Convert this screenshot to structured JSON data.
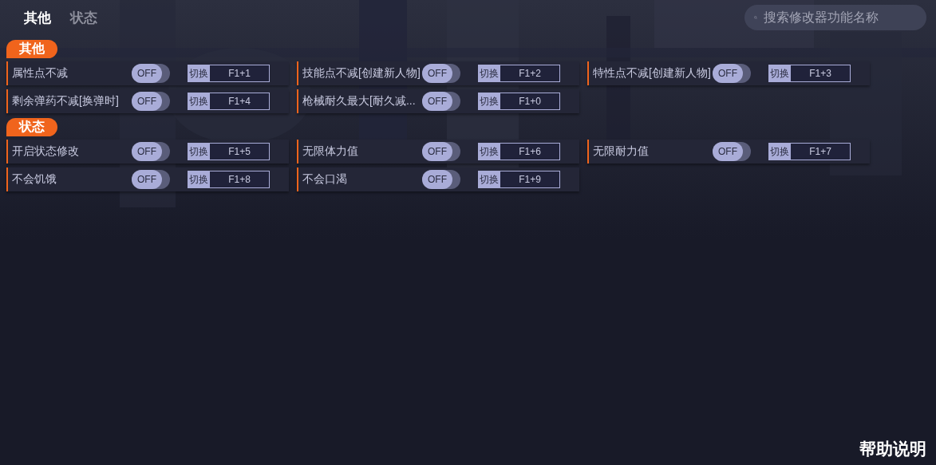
{
  "tabs": [
    {
      "label": "其他",
      "selected": true
    },
    {
      "label": "状态",
      "selected": false
    }
  ],
  "search": {
    "placeholder": "搜索修改器功能名称"
  },
  "sections": [
    {
      "title": "其他",
      "items": [
        {
          "name": "属性点不减",
          "toggle": "OFF",
          "on": false,
          "action": "切换",
          "hotkey": "F1+1"
        },
        {
          "name": "技能点不减[创建新人物]",
          "toggle": "OFF",
          "on": false,
          "action": "切换",
          "hotkey": "F1+2"
        },
        {
          "name": "特性点不减[创建新人物]",
          "toggle": "OFF",
          "on": false,
          "action": "切换",
          "hotkey": "F1+3"
        },
        {
          "name": "剩余弹药不减[换弹时]",
          "toggle": "OFF",
          "on": false,
          "action": "切换",
          "hotkey": "F1+4"
        },
        {
          "name": "枪械耐久最大[耐久减...",
          "toggle": "OFF",
          "on": false,
          "action": "切换",
          "hotkey": "F1+0"
        }
      ]
    },
    {
      "title": "状态",
      "items": [
        {
          "name": "开启状态修改",
          "toggle": "OFF",
          "on": false,
          "action": "切换",
          "hotkey": "F1+5"
        },
        {
          "name": "无限体力值",
          "toggle": "OFF",
          "on": false,
          "action": "切换",
          "hotkey": "F1+6"
        },
        {
          "name": "无限耐力值",
          "toggle": "OFF",
          "on": false,
          "action": "切换",
          "hotkey": "F1+7"
        },
        {
          "name": "不会饥饿",
          "toggle": "OFF",
          "on": false,
          "action": "切换",
          "hotkey": "F1+8"
        },
        {
          "name": "不会口渴",
          "toggle": "OFF",
          "on": false,
          "action": "切换",
          "hotkey": "F1+9"
        }
      ]
    }
  ],
  "help": "帮助说明"
}
